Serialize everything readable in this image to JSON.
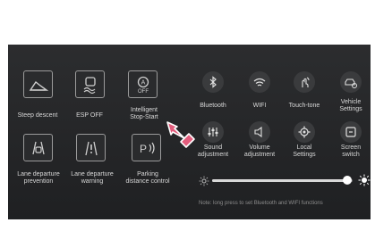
{
  "left_buttons": [
    {
      "label_lines": [
        "Steep descent"
      ],
      "icon": "steep-descent-icon"
    },
    {
      "label_lines": [
        "ESP OFF"
      ],
      "icon": "esp-off-icon"
    },
    {
      "label_lines": [
        "Intelligent",
        "Stop-Start"
      ],
      "icon": "stop-start-icon",
      "icon_text": "OFF"
    },
    {
      "label_lines": [
        "Lane departure",
        "prevention"
      ],
      "icon": "lane-departure-prevention-icon"
    },
    {
      "label_lines": [
        "Lane departure",
        "warning"
      ],
      "icon": "lane-departure-warning-icon"
    },
    {
      "label_lines": [
        "Parking",
        "distance control"
      ],
      "icon": "parking-distance-control-icon"
    }
  ],
  "right_buttons": [
    {
      "label_lines": [
        "Bluetooth"
      ],
      "icon": "bluetooth-icon"
    },
    {
      "label_lines": [
        "WIFI"
      ],
      "icon": "wifi-icon"
    },
    {
      "label_lines": [
        "Touch-tone"
      ],
      "icon": "touch-tone-icon"
    },
    {
      "label_lines": [
        "Vehicle",
        "Settings"
      ],
      "icon": "vehicle-settings-icon"
    },
    {
      "label_lines": [
        "Sound",
        "adjustment"
      ],
      "icon": "sound-adjustment-icon"
    },
    {
      "label_lines": [
        "Volume",
        "adjustment"
      ],
      "icon": "volume-adjustment-icon"
    },
    {
      "label_lines": [
        "Local",
        "Settings"
      ],
      "icon": "local-settings-icon"
    },
    {
      "label_lines": [
        "Screen",
        "switch"
      ],
      "icon": "screen-switch-icon"
    }
  ],
  "brightness": {
    "level_fraction": 0.96,
    "low_icon": "sun-small-icon",
    "high_icon": "sun-large-icon"
  },
  "note": "Note: long press to set Bluetooth and WIFI functions",
  "pointer_icon": "pointing-hand-icon",
  "colors": {
    "panel": "#252628",
    "accent_pointer": "#e35d7d",
    "text": "#d8d8d8"
  }
}
